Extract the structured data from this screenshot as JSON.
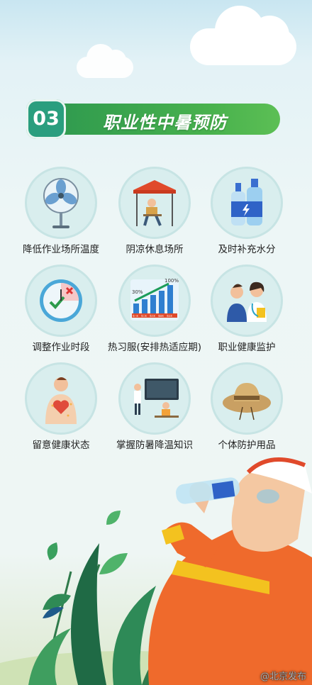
{
  "header": {
    "number": "03",
    "title": "职业性中暑预防"
  },
  "items": [
    {
      "label": "降低作业场所温度",
      "icon": "electric-fan-icon"
    },
    {
      "label": "阴凉休息场所",
      "icon": "shade-tent-rest-icon"
    },
    {
      "label": "及时补充水分",
      "icon": "water-bottles-icon"
    },
    {
      "label": "调整作业时段",
      "icon": "clock-icon"
    },
    {
      "label": "热习服(安排热适应期)",
      "icon": "acclimatization-chart-icon",
      "chart_text": {
        "start_pct": "30%",
        "end_pct": "100%",
        "days": [
          "第一天",
          "第二天",
          "第三天",
          "第四天",
          "第五天"
        ]
      }
    },
    {
      "label": "职业健康监护",
      "icon": "doctor-patient-icon"
    },
    {
      "label": "留意健康状态",
      "icon": "heart-body-icon"
    },
    {
      "label": "掌握防暑降温知识",
      "icon": "classroom-training-icon"
    },
    {
      "label": "个体防护用品",
      "icon": "straw-hat-icon"
    }
  ],
  "watermark": "@北京发布",
  "colors": {
    "header_green": "#49b24d",
    "number_teal": "#2a9e7e",
    "worker_orange": "#ef6a2c",
    "reflective_yellow": "#f3c21f"
  }
}
